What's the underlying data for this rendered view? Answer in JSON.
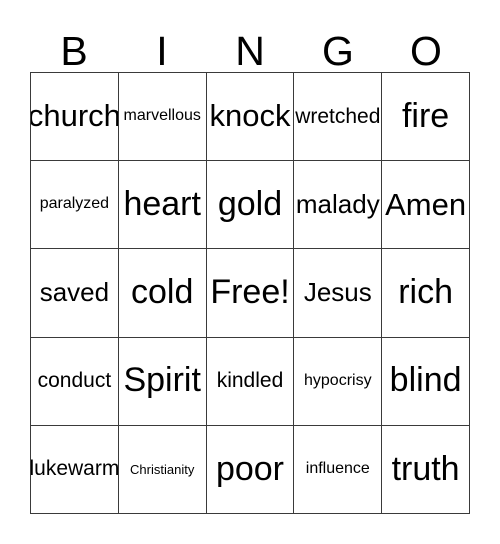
{
  "card": {
    "title": "BINGO",
    "header_letters": [
      "B",
      "I",
      "N",
      "G",
      "O"
    ],
    "columns": 5,
    "rows": 5,
    "free_space": "Free!",
    "grid_color": "#3a3a3a",
    "text_color": "#000000",
    "background_color": "#ffffff",
    "rows_data": [
      {
        "cells": [
          {
            "text": "church",
            "size": "lg"
          },
          {
            "text": "marvellous",
            "size": "xs"
          },
          {
            "text": "knock",
            "size": "lg"
          },
          {
            "text": "wretched",
            "size": "sm"
          },
          {
            "text": "fire",
            "size": "xl"
          }
        ]
      },
      {
        "cells": [
          {
            "text": "paralyzed",
            "size": "xs"
          },
          {
            "text": "heart",
            "size": "xl"
          },
          {
            "text": "gold",
            "size": "xl"
          },
          {
            "text": "malady",
            "size": "md"
          },
          {
            "text": "Amen",
            "size": "lg"
          }
        ]
      },
      {
        "cells": [
          {
            "text": "saved",
            "size": "md"
          },
          {
            "text": "cold",
            "size": "xl"
          },
          {
            "text": "Free!",
            "size": "xl"
          },
          {
            "text": "Jesus",
            "size": "md"
          },
          {
            "text": "rich",
            "size": "xl"
          }
        ]
      },
      {
        "cells": [
          {
            "text": "conduct",
            "size": "sm"
          },
          {
            "text": "Spirit",
            "size": "xl"
          },
          {
            "text": "kindled",
            "size": "sm"
          },
          {
            "text": "hypocrisy",
            "size": "xs"
          },
          {
            "text": "blind",
            "size": "xl"
          }
        ]
      },
      {
        "cells": [
          {
            "text": "lukewarm",
            "size": "sm"
          },
          {
            "text": "Christianity",
            "size": "xxs"
          },
          {
            "text": "poor",
            "size": "xl"
          },
          {
            "text": "influence",
            "size": "xs"
          },
          {
            "text": "truth",
            "size": "xl"
          }
        ]
      }
    ]
  }
}
